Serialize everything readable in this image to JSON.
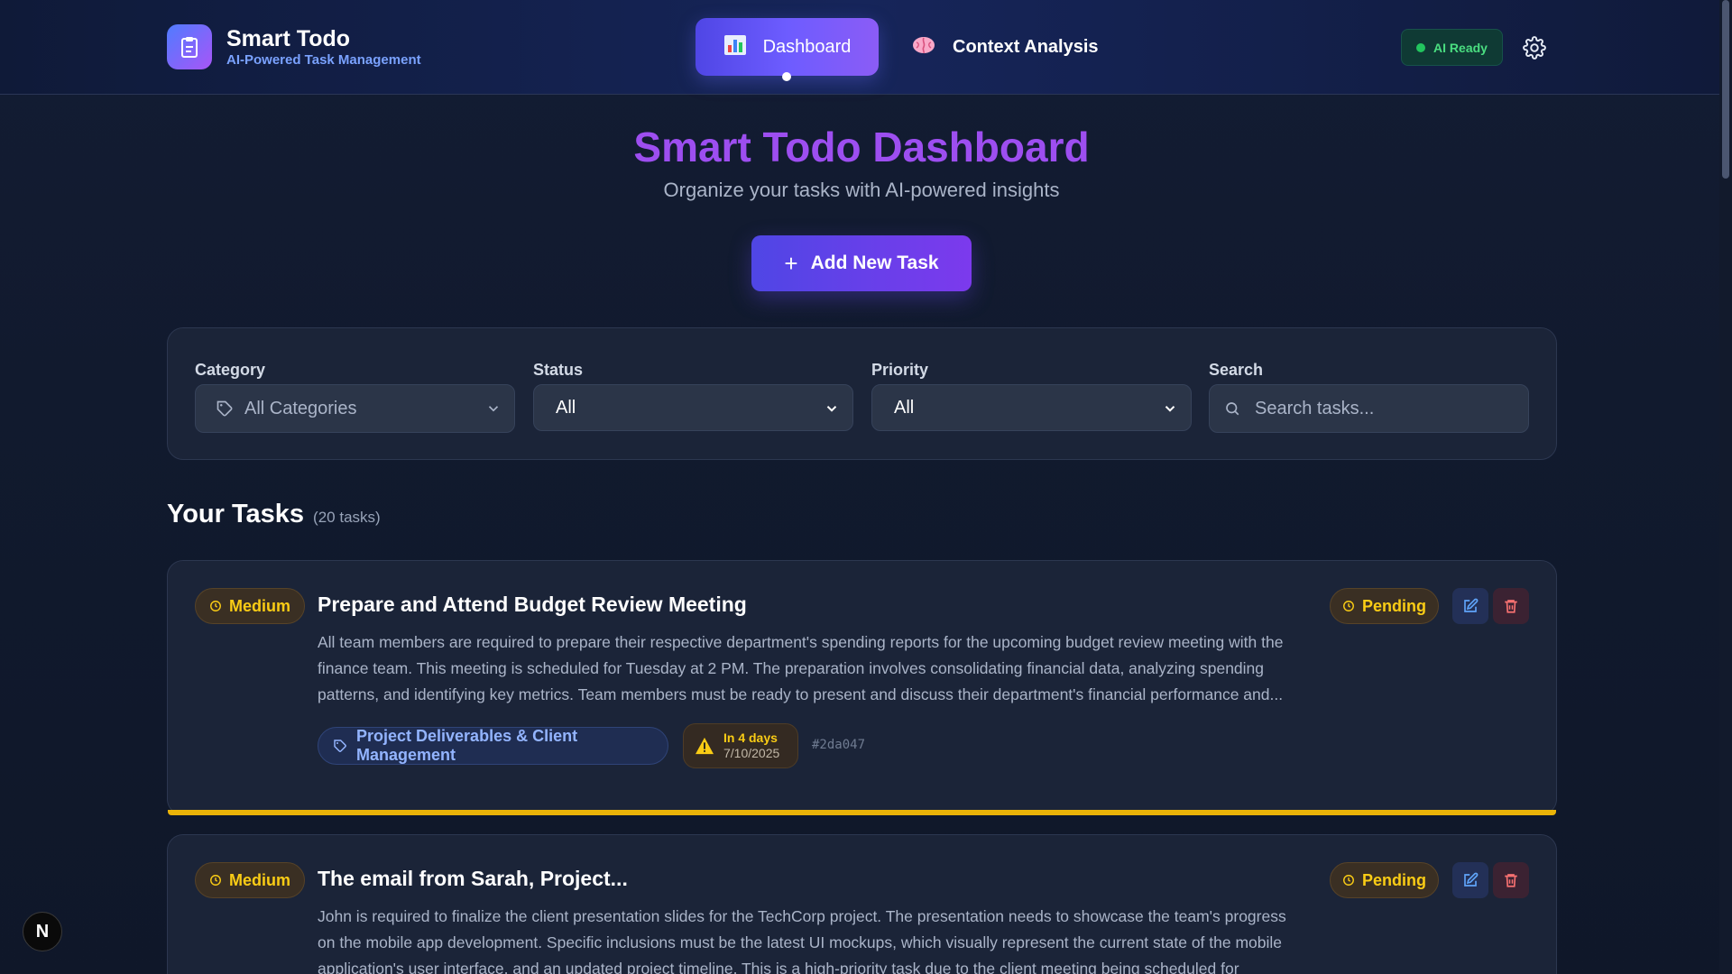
{
  "header": {
    "brand_title": "Smart Todo",
    "brand_subtitle": "AI-Powered Task Management",
    "nav": [
      {
        "label": "Dashboard",
        "icon": "bar-chart-icon",
        "active": true
      },
      {
        "label": "Context Analysis",
        "icon": "brain-icon",
        "active": false
      }
    ],
    "ai_status": "AI Ready",
    "ai_status_color": "#22c55e"
  },
  "hero": {
    "title": "Smart Todo Dashboard",
    "subtitle": "Organize your tasks with AI-powered insights",
    "add_button": "Add New Task"
  },
  "filters": {
    "category": {
      "label": "Category",
      "value": "All Categories"
    },
    "status": {
      "label": "Status",
      "value": "All"
    },
    "priority": {
      "label": "Priority",
      "value": "All"
    },
    "search": {
      "label": "Search",
      "placeholder": "Search tasks..."
    }
  },
  "tasks_section": {
    "heading": "Your Tasks",
    "count": "(20 tasks)"
  },
  "tasks": [
    {
      "priority": "Medium",
      "title": "Prepare and Attend Budget Review Meeting",
      "description": "All team members are required to prepare their respective department's spending reports for the upcoming budget review meeting with the finance team. This meeting is scheduled for Tuesday at 2 PM. The preparation involves consolidating financial data, analyzing spending patterns, and identifying key metrics. Team members must be ready to present and discuss their department's financial performance and...",
      "status": "Pending",
      "category": "Project Deliverables & Client Management",
      "due_relative": "In 4 days",
      "due_date": "7/10/2025",
      "id": "#2da047",
      "accent_color": "#eab308"
    },
    {
      "priority": "Medium",
      "title": "The email from Sarah, Project...",
      "description": "John is required to finalize the client presentation slides for the TechCorp project. The presentation needs to showcase the team's progress on the mobile app development. Specific inclusions must be the latest UI mockups, which visually represent the current state of the mobile application's user interface, and an updated project timeline. This is a high-priority task due to the client meeting being scheduled for Friday,...",
      "status": "Pending"
    }
  ],
  "colors": {
    "accent": "#6d5cff",
    "priority_medium": "#facc15",
    "title_gradient": "#9d4ef0"
  }
}
